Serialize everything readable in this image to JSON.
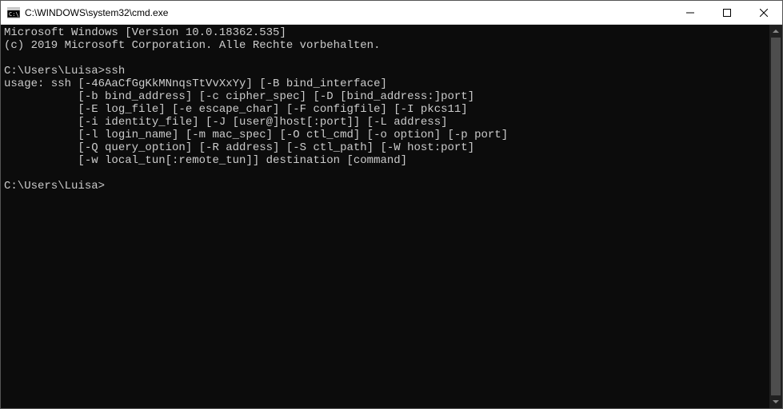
{
  "window": {
    "title": "C:\\WINDOWS\\system32\\cmd.exe"
  },
  "terminal": {
    "lines": [
      "Microsoft Windows [Version 10.0.18362.535]",
      "(c) 2019 Microsoft Corporation. Alle Rechte vorbehalten.",
      "",
      "C:\\Users\\Luisa>ssh",
      "usage: ssh [-46AaCfGgKkMNnqsTtVvXxYy] [-B bind_interface]",
      "           [-b bind_address] [-c cipher_spec] [-D [bind_address:]port]",
      "           [-E log_file] [-e escape_char] [-F configfile] [-I pkcs11]",
      "           [-i identity_file] [-J [user@]host[:port]] [-L address]",
      "           [-l login_name] [-m mac_spec] [-O ctl_cmd] [-o option] [-p port]",
      "           [-Q query_option] [-R address] [-S ctl_path] [-W host:port]",
      "           [-w local_tun[:remote_tun]] destination [command]",
      "",
      "C:\\Users\\Luisa>"
    ]
  }
}
